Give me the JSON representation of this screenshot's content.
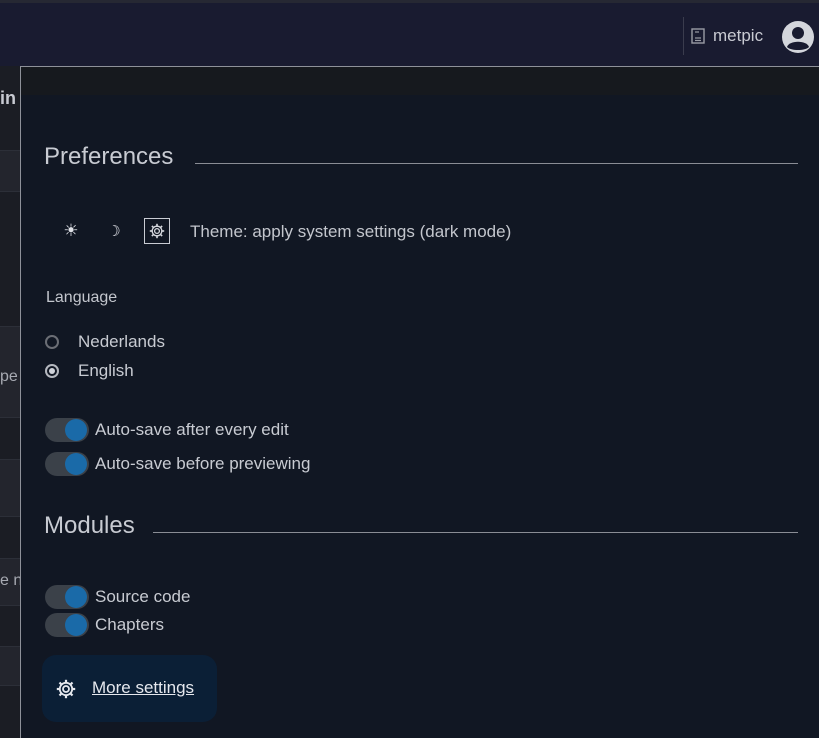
{
  "topbar": {
    "username": "metpic",
    "doc_icon": "document-icon",
    "avatar_icon": "user-avatar-icon"
  },
  "background_page": {
    "fragments": [
      "in",
      "pe",
      "e n"
    ]
  },
  "preferences": {
    "title": "Preferences",
    "theme": {
      "options": [
        {
          "name": "light",
          "icon": "sun-icon",
          "glyph": "☀"
        },
        {
          "name": "dark",
          "icon": "moon-icon",
          "glyph": "☽"
        },
        {
          "name": "system",
          "icon": "system-gear-icon",
          "glyph": "⚙"
        }
      ],
      "selected": "system",
      "label": "Theme: apply system settings (dark mode)"
    },
    "language": {
      "label": "Language",
      "options": [
        {
          "label": "Nederlands",
          "checked": false
        },
        {
          "label": "English",
          "checked": true
        }
      ]
    },
    "toggles": [
      {
        "label": "Auto-save after every edit",
        "on": true
      },
      {
        "label": "Auto-save before previewing",
        "on": true
      }
    ]
  },
  "modules": {
    "title": "Modules",
    "toggles": [
      {
        "label": "Source code",
        "on": true
      },
      {
        "label": "Chapters",
        "on": true
      }
    ]
  },
  "more_settings": {
    "label": "More settings",
    "icon": "gear-icon"
  },
  "colors": {
    "accent": "#1a6aa8",
    "panel_bg": "#111723",
    "topbar_bg": "#191b30",
    "button_bg": "#0b1f36"
  }
}
